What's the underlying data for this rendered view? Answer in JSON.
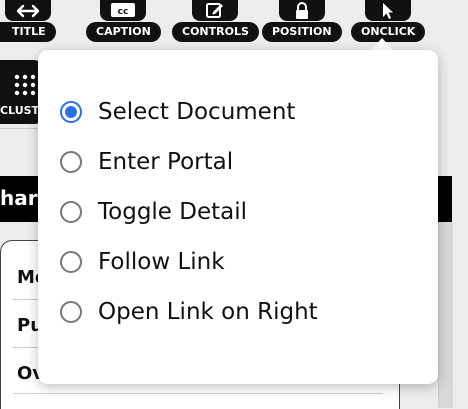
{
  "toolbar": {
    "buttons": [
      {
        "label": "TITLE",
        "icon": "resize-horizontal-icon"
      },
      {
        "label": "CAPTION",
        "icon": "closed-caption-icon"
      },
      {
        "label": "CONTROLS",
        "icon": "edit-icon"
      },
      {
        "label": "POSITION",
        "icon": "lock-icon"
      },
      {
        "label": "ONCLICK",
        "icon": "cursor-icon"
      }
    ]
  },
  "sidebar": {
    "cluster_label": "CLUSTE",
    "cluster_icon": "grid-dots-icon"
  },
  "background": {
    "band_text": "har",
    "rows": [
      "Mo",
      "Pu",
      "Ov"
    ]
  },
  "onclick_menu": {
    "options": [
      {
        "label": "Select Document",
        "selected": true
      },
      {
        "label": "Enter Portal",
        "selected": false
      },
      {
        "label": "Toggle Detail",
        "selected": false
      },
      {
        "label": "Follow Link",
        "selected": false
      },
      {
        "label": "Open Link on Right",
        "selected": false
      }
    ]
  },
  "colors": {
    "accent": "#2f6fe3",
    "toolbar_bg": "#111111",
    "page_bg": "#ededed"
  }
}
